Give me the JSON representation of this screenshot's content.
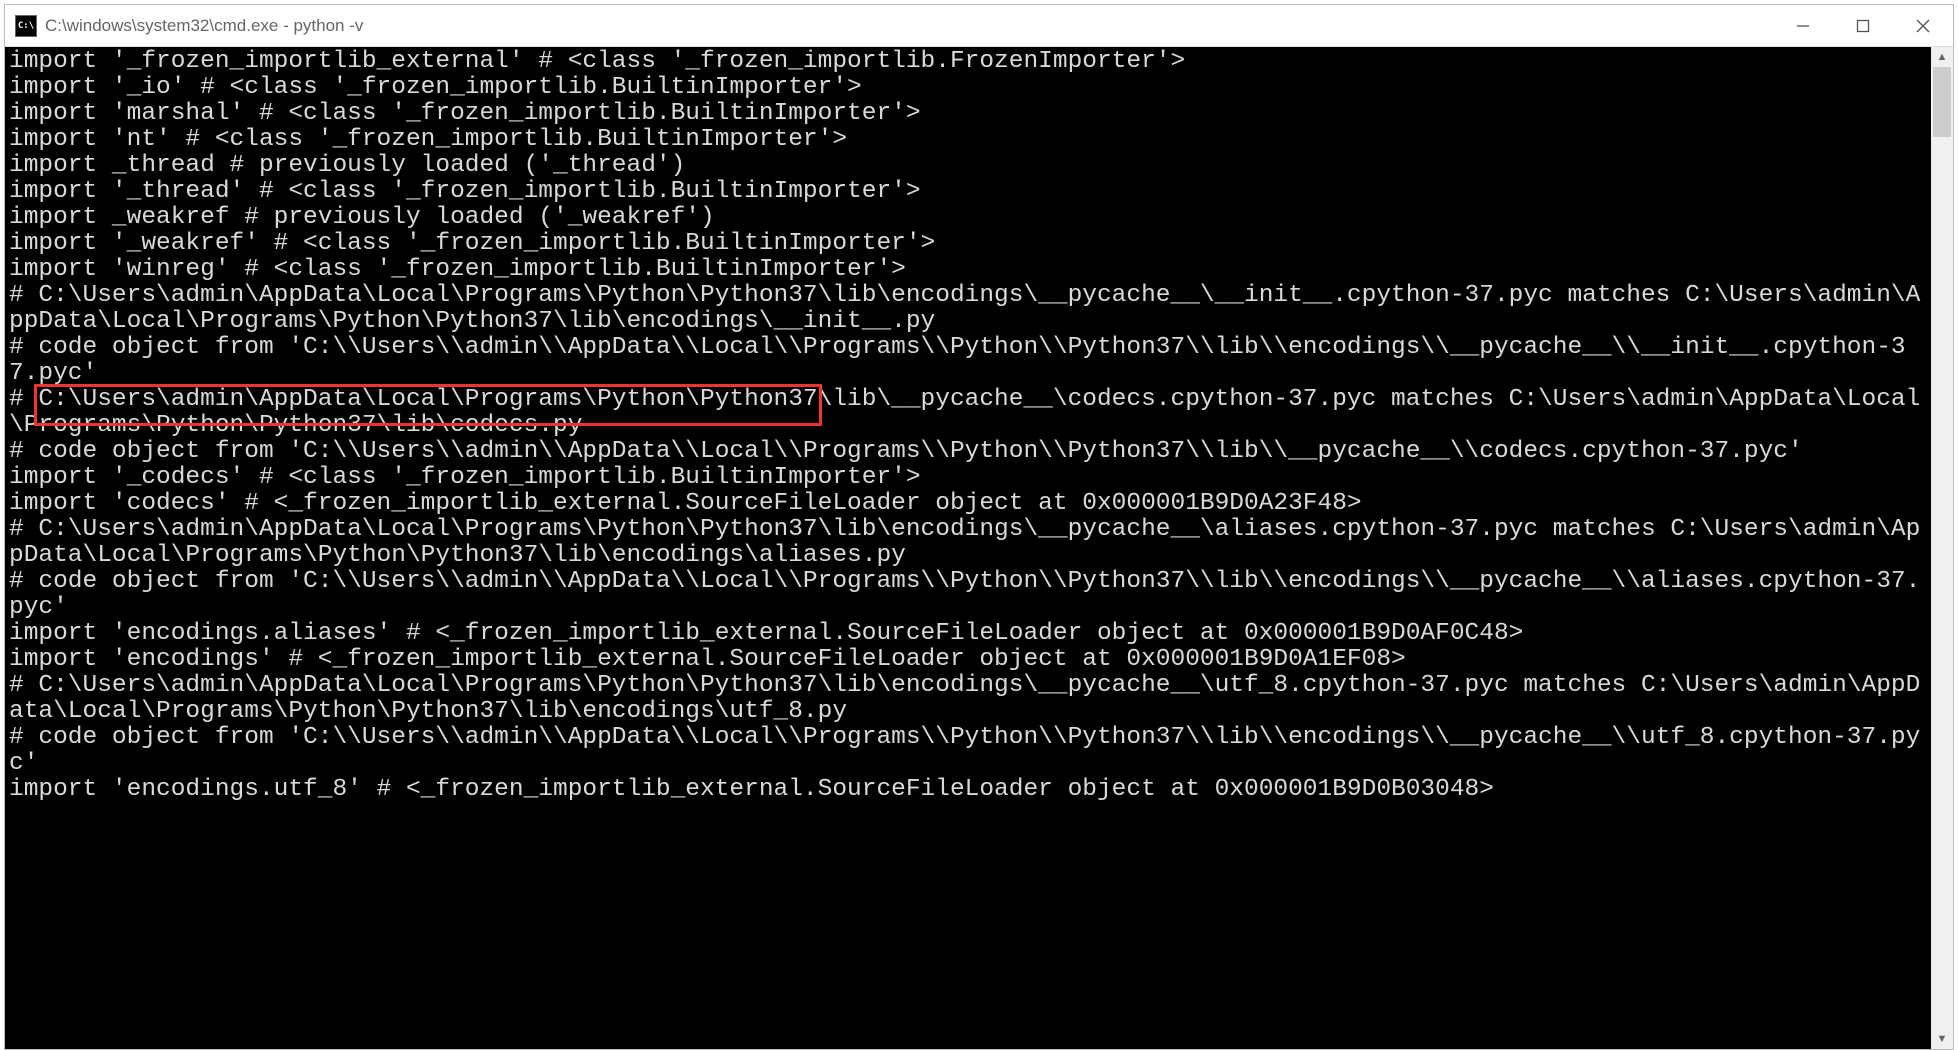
{
  "window": {
    "title": "C:\\windows\\system32\\cmd.exe - python  -v",
    "icon_label": "C:\\"
  },
  "highlight": {
    "text": "C:\\Users\\admin\\AppData\\Local\\Programs\\Python\\Python37"
  },
  "terminal_lines": [
    "import '_frozen_importlib_external' # <class '_frozen_importlib.FrozenImporter'>",
    "import '_io' # <class '_frozen_importlib.BuiltinImporter'>",
    "import 'marshal' # <class '_frozen_importlib.BuiltinImporter'>",
    "import 'nt' # <class '_frozen_importlib.BuiltinImporter'>",
    "import _thread # previously loaded ('_thread')",
    "import '_thread' # <class '_frozen_importlib.BuiltinImporter'>",
    "import _weakref # previously loaded ('_weakref')",
    "import '_weakref' # <class '_frozen_importlib.BuiltinImporter'>",
    "import 'winreg' # <class '_frozen_importlib.BuiltinImporter'>",
    "# C:\\Users\\admin\\AppData\\Local\\Programs\\Python\\Python37\\lib\\encodings\\__pycache__\\__init__.cpython-37.pyc matches C:\\Users\\admin\\AppData\\Local\\Programs\\Python\\Python37\\lib\\encodings\\__init__.py",
    "# code object from 'C:\\\\Users\\\\admin\\\\AppData\\\\Local\\\\Programs\\\\Python\\\\Python37\\\\lib\\\\encodings\\\\__pycache__\\\\__init__.cpython-37.pyc'",
    "# C:\\Users\\admin\\AppData\\Local\\Programs\\Python\\Python37\\lib\\__pycache__\\codecs.cpython-37.pyc matches C:\\Users\\admin\\AppData\\Local\\Programs\\Python\\Python37\\lib\\codecs.py",
    "# code object from 'C:\\\\Users\\\\admin\\\\AppData\\\\Local\\\\Programs\\\\Python\\\\Python37\\\\lib\\\\__pycache__\\\\codecs.cpython-37.pyc'",
    "import '_codecs' # <class '_frozen_importlib.BuiltinImporter'>",
    "import 'codecs' # <_frozen_importlib_external.SourceFileLoader object at 0x000001B9D0A23F48>",
    "# C:\\Users\\admin\\AppData\\Local\\Programs\\Python\\Python37\\lib\\encodings\\__pycache__\\aliases.cpython-37.pyc matches C:\\Users\\admin\\AppData\\Local\\Programs\\Python\\Python37\\lib\\encodings\\aliases.py",
    "# code object from 'C:\\\\Users\\\\admin\\\\AppData\\\\Local\\\\Programs\\\\Python\\\\Python37\\\\lib\\\\encodings\\\\__pycache__\\\\aliases.cpython-37.pyc'",
    "import 'encodings.aliases' # <_frozen_importlib_external.SourceFileLoader object at 0x000001B9D0AF0C48>",
    "import 'encodings' # <_frozen_importlib_external.SourceFileLoader object at 0x000001B9D0A1EF08>",
    "# C:\\Users\\admin\\AppData\\Local\\Programs\\Python\\Python37\\lib\\encodings\\__pycache__\\utf_8.cpython-37.pyc matches C:\\Users\\admin\\AppData\\Local\\Programs\\Python\\Python37\\lib\\encodings\\utf_8.py",
    "# code object from 'C:\\\\Users\\\\admin\\\\AppData\\\\Local\\\\Programs\\\\Python\\\\Python37\\\\lib\\\\encodings\\\\__pycache__\\\\utf_8.cpython-37.pyc'",
    "import 'encodings.utf_8' # <_frozen_importlib_external.SourceFileLoader object at 0x000001B9D0B03048>"
  ],
  "scrollbar": {
    "thumb_top_pct": 2,
    "thumb_height_pct": 7
  }
}
